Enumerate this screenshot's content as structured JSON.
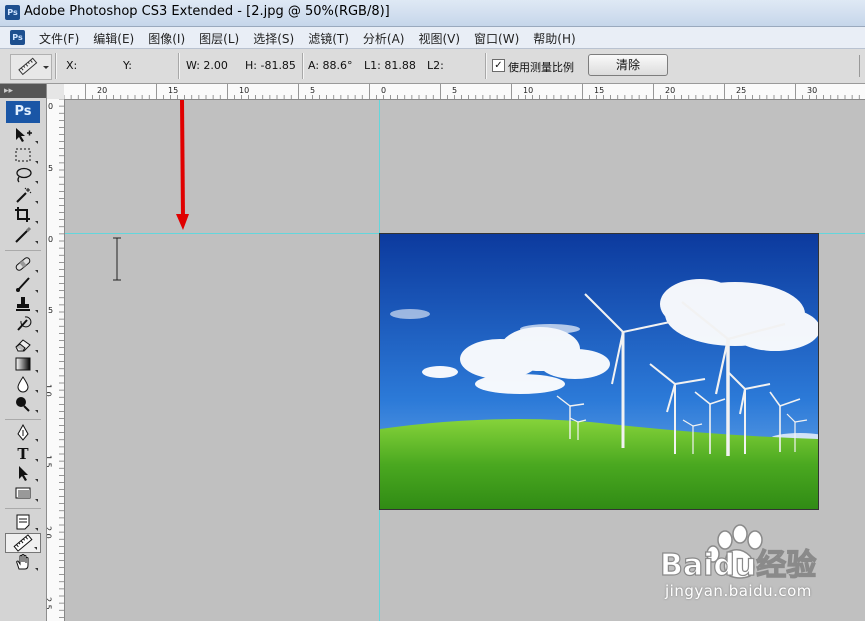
{
  "window": {
    "title": "Adobe Photoshop CS3 Extended - [2.jpg @ 50%(RGB/8)]",
    "app_icon": "Ps"
  },
  "menu": [
    "文件(F)",
    "编辑(E)",
    "图像(I)",
    "图层(L)",
    "选择(S)",
    "滤镜(T)",
    "分析(A)",
    "视图(V)",
    "窗口(W)",
    "帮助(H)"
  ],
  "options": {
    "x_label": "X:",
    "y_label": "Y:",
    "w": "W: 2.00",
    "h": "H: -81.85",
    "a": "A: 88.6°",
    "l1": "L1: 81.88",
    "l2": "L2:",
    "use_scale_checked": true,
    "use_scale_label": "使用测量比例",
    "clear_label": "清除"
  },
  "toolbox": {
    "header": "▸▸",
    "logo": "Ps",
    "tools": [
      "move",
      "marquee",
      "lasso",
      "magic-wand",
      "crop",
      "slice",
      "healing-brush",
      "brush",
      "clone-stamp",
      "history-brush",
      "eraser",
      "gradient",
      "blur",
      "dodge",
      "pen",
      "type",
      "path-selection",
      "shape",
      "notes",
      "measure",
      "hand"
    ],
    "selected": "measure"
  },
  "rulers": {
    "h_labels": [
      "20",
      "15",
      "10",
      "5",
      "0",
      "5",
      "10",
      "15",
      "20",
      "25",
      "30"
    ],
    "v_labels": [
      "0",
      "5",
      "0",
      "5",
      "1 0",
      "1 5",
      "2 0",
      "2 5"
    ]
  },
  "watermark": {
    "brand": "Baidu经验",
    "url": "jingyan.baidu.com"
  },
  "colors": {
    "guide": "#63d6dc",
    "arrow": "#e00000",
    "sky": "#1b5fc8",
    "grass": "#4aa820"
  }
}
